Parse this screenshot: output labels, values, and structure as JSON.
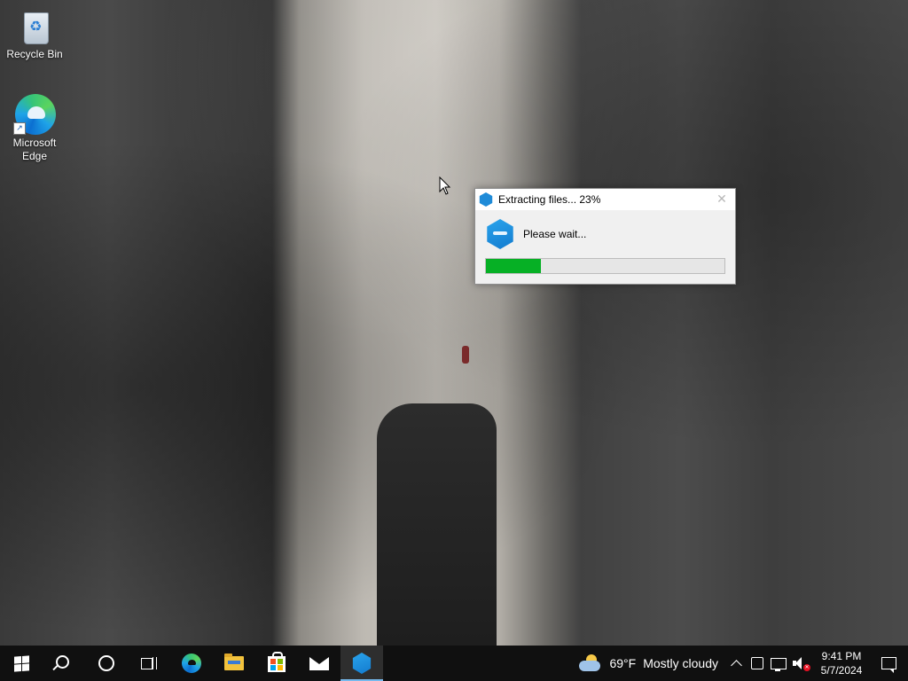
{
  "desktop": {
    "icons": [
      {
        "label": "Recycle Bin",
        "icon": "recycle-bin-icon"
      },
      {
        "label": "Microsoft\nEdge",
        "label_line1": "Microsoft",
        "label_line2": "Edge",
        "icon": "edge-icon"
      }
    ]
  },
  "dialog": {
    "title": "Extracting files... 23%",
    "message": "Please wait...",
    "progress_percent": 23,
    "close_glyph": "✕",
    "progress_color": "#06b025"
  },
  "taskbar": {
    "start_icon": "windows-logo-icon",
    "apps": [
      {
        "name": "search",
        "icon": "search-icon"
      },
      {
        "name": "cortana",
        "icon": "cortana-icon"
      },
      {
        "name": "task-view",
        "icon": "task-view-icon"
      },
      {
        "name": "edge",
        "icon": "edge-icon"
      },
      {
        "name": "file-explorer",
        "icon": "folder-icon"
      },
      {
        "name": "store",
        "icon": "store-icon"
      },
      {
        "name": "mail",
        "icon": "mail-icon"
      },
      {
        "name": "installer",
        "icon": "installer-app-icon",
        "active": true
      }
    ],
    "weather": {
      "temperature": "69°F",
      "condition": "Mostly cloudy"
    },
    "clock": {
      "time": "9:41 PM",
      "date": "5/7/2024"
    }
  }
}
